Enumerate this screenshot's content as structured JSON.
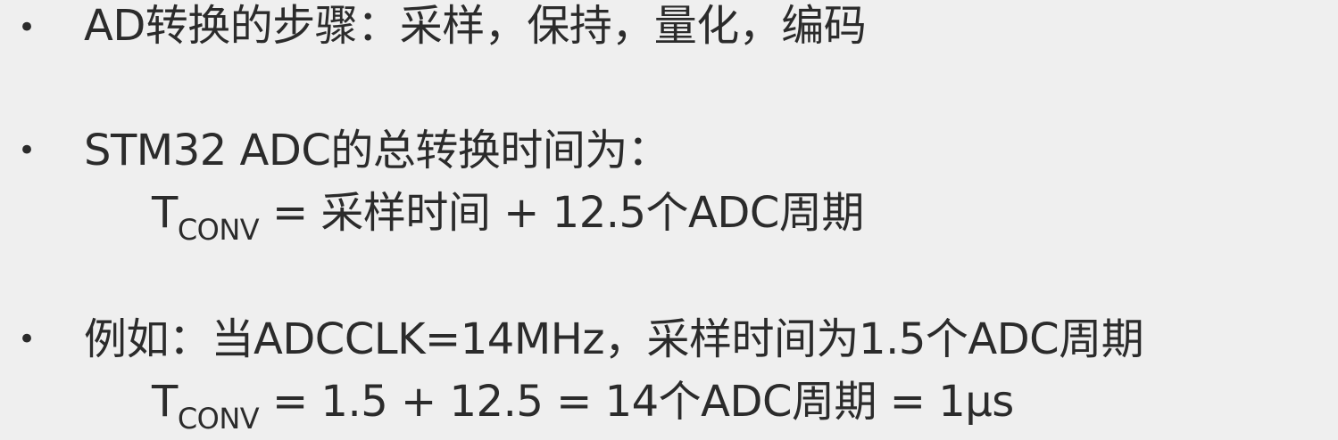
{
  "bullets": [
    {
      "marker": "•",
      "text": "AD转换的步骤：采样，保持，量化，编码"
    },
    {
      "marker": "•",
      "text": "STM32 ADC的总转换时间为：",
      "formula": {
        "symbol": "T",
        "subscript": "CONV",
        "rhs": " = 采样时间 + 12.5个ADC周期"
      }
    },
    {
      "marker": "•",
      "text": "例如：当ADCCLK=14MHz，采样时间为1.5个ADC周期",
      "formula": {
        "symbol": "T",
        "subscript": "CONV",
        "rhs": " = 1.5 + 12.5 = 14个ADC周期 = 1μs"
      }
    }
  ]
}
